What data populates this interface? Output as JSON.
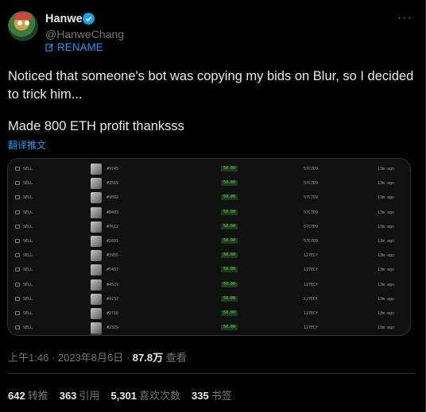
{
  "author": {
    "name": "Hanwe",
    "handle": "@HanweChang",
    "rename_label": "RENAME"
  },
  "tweet": {
    "line1": "Noticed that someone's bot was copying my bids on Blur, so I decided to trick him...",
    "line2": "Made 800 ETH profit thanksss",
    "translate_label": "翻译推文"
  },
  "media": {
    "rows": [
      {
        "action": "SELL",
        "id": "#9745",
        "price": "50.00",
        "addr": "57C7D9",
        "time": "13m ago"
      },
      {
        "action": "SELL",
        "id": "#3569",
        "price": "50.00",
        "addr": "57C7D9",
        "time": "13m ago"
      },
      {
        "action": "SELL",
        "id": "#9092",
        "price": "50.00",
        "addr": "57C7D9",
        "time": "13m ago"
      },
      {
        "action": "SELL",
        "id": "#8403",
        "price": "50.00",
        "addr": "57C7D9",
        "time": "13m ago"
      },
      {
        "action": "SELL",
        "id": "#7612",
        "price": "50.00",
        "addr": "57C7D9",
        "time": "13m ago"
      },
      {
        "action": "SELL",
        "id": "#1691",
        "price": "50.00",
        "addr": "57C7D9",
        "time": "13m ago"
      },
      {
        "action": "SELL",
        "id": "#5955",
        "price": "50.00",
        "addr": "127ECf",
        "time": "13m ago"
      },
      {
        "action": "SELL",
        "id": "#5407",
        "price": "50.00",
        "addr": "127ECf",
        "time": "13m ago"
      },
      {
        "action": "SELL",
        "id": "#4521",
        "price": "50.00",
        "addr": "127ECf",
        "time": "13m ago"
      },
      {
        "action": "SELL",
        "id": "#4237",
        "price": "50.00",
        "addr": "127ECf",
        "time": "13m ago"
      },
      {
        "action": "SELL",
        "id": "#2716",
        "price": "50.00",
        "addr": "127ECf",
        "time": "13m ago"
      },
      {
        "action": "SELL",
        "id": "#2329",
        "price": "50.00",
        "addr": "127ECf",
        "time": "13m ago"
      }
    ]
  },
  "meta": {
    "timestamp": "上午1:46 · 2023年8月6日 · ",
    "views": "87.8万",
    "views_label": " 查看"
  },
  "stats": {
    "retweets": "642",
    "retweets_label": "转推",
    "quotes": "363",
    "quotes_label": "引用",
    "likes": "5,301",
    "likes_label": "喜欢次数",
    "bookmarks": "335",
    "bookmarks_label": "书签"
  },
  "colors": {
    "accent": "#1d9bf0",
    "price_green": "#6fdc4f",
    "muted": "#71767b"
  },
  "icons": [
    "verified-badge-icon",
    "edit-icon",
    "more-icon",
    "marketplace-icon"
  ]
}
